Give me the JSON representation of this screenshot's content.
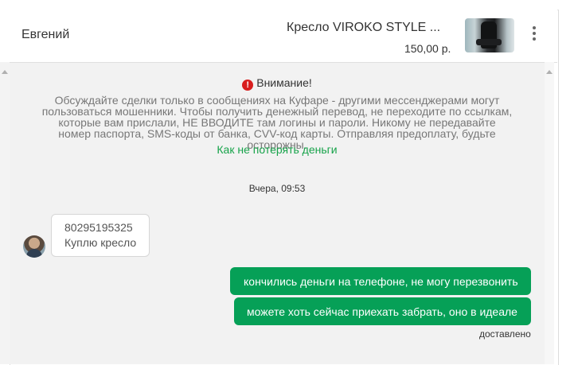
{
  "header": {
    "seller_name": "Евгений",
    "product_title": "Кресло VIROKO STYLE ...",
    "price": "150,00 р."
  },
  "warning": {
    "title": "Внимание!",
    "text": "Обсуждайте сделки только в сообщениях на Куфаре - другими мессенджерами могут пользоваться мошенники. Чтобы получить денежный перевод, не переходите по ссылкам, которые вам прислали, НЕ ВВОДИТЕ там логины и пароли. Никому не передавайте номер паспорта, SMS-коды от банка, CVV-код карты. Отправляя предоплату, будьте осторожны.",
    "link": "Как не потерять деньги"
  },
  "date_separator": "Вчера, 09:53",
  "messages": [
    {
      "direction": "in",
      "lines": [
        "80295195325",
        "Куплю кресло"
      ]
    },
    {
      "direction": "out",
      "text": "кончились деньги на телефоне, не могу перезвонить"
    },
    {
      "direction": "out",
      "text": "можете хоть сейчас приехать забрать, оно в идеале"
    }
  ],
  "delivery_status": "доставлено",
  "colors": {
    "accent_green": "#06a057",
    "link_green": "#17a34a",
    "warning_red": "#d81e1e",
    "chat_background": "#f2f2f2"
  },
  "icons": {
    "warning": "exclamation-circle-icon",
    "menu": "kebab-menu-icon"
  }
}
